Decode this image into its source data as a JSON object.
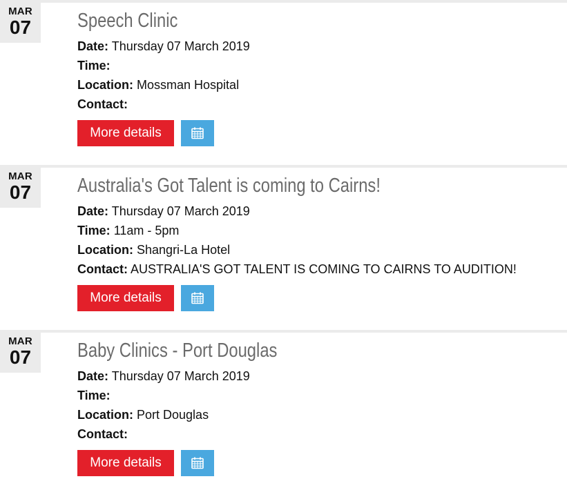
{
  "labels": {
    "date": "Date:",
    "time": "Time:",
    "location": "Location:",
    "contact": "Contact:"
  },
  "events": [
    {
      "month": "MAR",
      "day": "07",
      "title": "Speech Clinic",
      "date": "Thursday 07 March 2019",
      "time": "",
      "location": "Mossman Hospital",
      "contact": "",
      "button_label": "More details"
    },
    {
      "month": "MAR",
      "day": "07",
      "title": "Australia's Got Talent is coming to Cairns!",
      "date": "Thursday 07 March 2019",
      "time": "11am - 5pm",
      "location": "Shangri-La Hotel",
      "contact": "AUSTRALIA'S GOT TALENT IS COMING TO CAIRNS TO AUDITION!",
      "button_label": "More details"
    },
    {
      "month": "MAR",
      "day": "07",
      "title": "Baby Clinics - Port Douglas",
      "date": "Thursday 07 March 2019",
      "time": "",
      "location": "Port Douglas",
      "contact": "",
      "button_label": "More details"
    }
  ],
  "colors": {
    "accent_red": "#e3202a",
    "calendar_blue": "#4aa8df",
    "date_box_gray": "#ebebeb",
    "title_gray": "#6b6b6b"
  },
  "icons": {
    "calendar": "calendar-icon"
  }
}
